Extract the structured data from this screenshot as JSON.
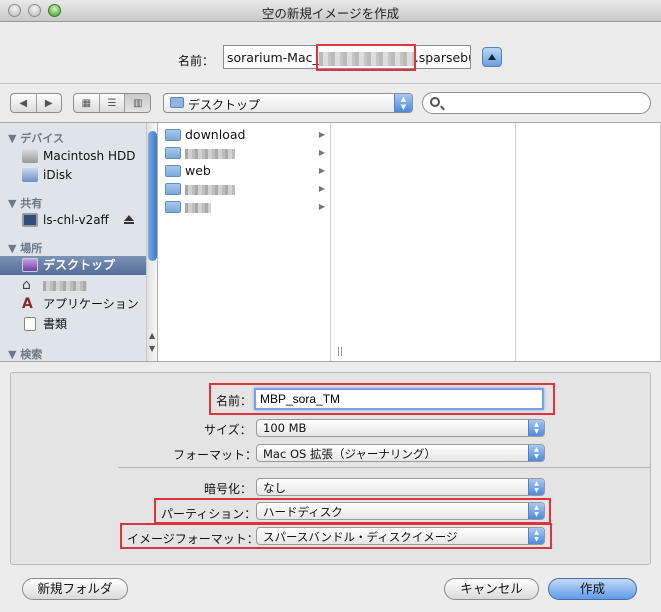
{
  "window": {
    "title": "空の新規イメージを作成"
  },
  "save_as": {
    "label": "名前：",
    "value_prefix": "sorarium-Mac_",
    "value_suffix": ".sparsebu"
  },
  "toolbar": {
    "location": "デスクトップ",
    "search_placeholder": ""
  },
  "sidebar": {
    "devices_header": "デバイス",
    "devices": [
      "Macintosh HDD",
      "iDisk"
    ],
    "shared_header": "共有",
    "shared": [
      "ls-chl-v2aff"
    ],
    "places_header": "場所",
    "places": [
      "デスクトップ",
      "",
      "アプリケーション",
      "書類"
    ],
    "search_header": "検索"
  },
  "files": [
    "download",
    "",
    "web",
    "",
    ""
  ],
  "options": {
    "name_label": "名前：",
    "name_value": "MBP_sora_TM",
    "size_label": "サイズ：",
    "size_value": "100 MB",
    "format_label": "フォーマット：",
    "format_value": "Mac OS 拡張（ジャーナリング）",
    "encryption_label": "暗号化：",
    "encryption_value": "なし",
    "partition_label": "パーティション：",
    "partition_value": "ハードディスク",
    "image_format_label": "イメージフォーマット：",
    "image_format_value": "スパースバンドル・ディスクイメージ"
  },
  "buttons": {
    "new_folder": "新規フォルダ",
    "cancel": "キャンセル",
    "create": "作成"
  },
  "colors": {
    "highlight_box": "#e2323e",
    "selection": "#546c99",
    "accent": "#4d89dc"
  }
}
